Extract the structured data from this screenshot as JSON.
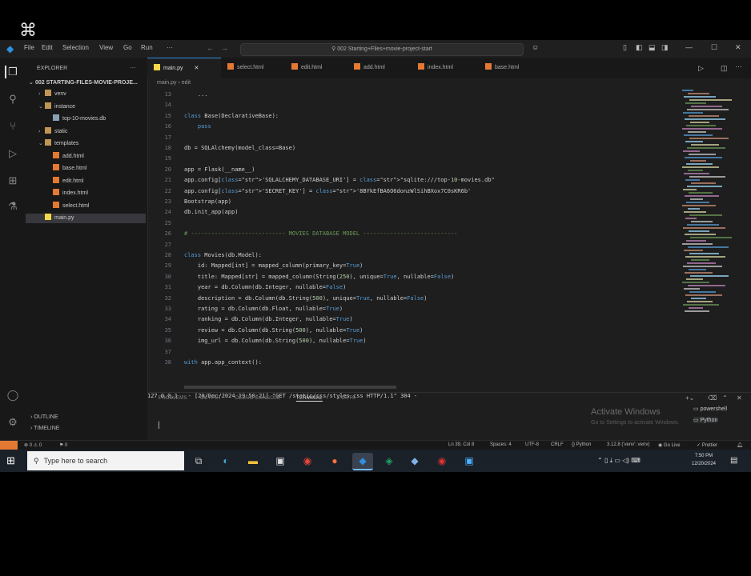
{
  "app": {
    "window_title": "002 Starting+Files+movie-project-start",
    "menu": [
      "File",
      "Edit",
      "Selection",
      "View",
      "Go",
      "Run",
      "···"
    ]
  },
  "sidebar": {
    "header": "EXPLORER",
    "root": "002 STARTING-FILES-MOVIE-PROJE...",
    "items": [
      {
        "label": "venv",
        "kind": "folder",
        "depth": 1
      },
      {
        "label": "instance",
        "kind": "folder",
        "depth": 1
      },
      {
        "label": "top-10-movies.db",
        "kind": "file",
        "depth": 2
      },
      {
        "label": "static",
        "kind": "folder",
        "depth": 1
      },
      {
        "label": "templates",
        "kind": "folder",
        "depth": 1
      },
      {
        "label": "add.html",
        "kind": "html",
        "depth": 2
      },
      {
        "label": "base.html",
        "kind": "html",
        "depth": 2
      },
      {
        "label": "edit.html",
        "kind": "html",
        "depth": 2
      },
      {
        "label": "index.html",
        "kind": "html",
        "depth": 2
      },
      {
        "label": "select.html",
        "kind": "html",
        "depth": 2
      },
      {
        "label": "main.py",
        "kind": "py",
        "depth": 1,
        "selected": true
      }
    ],
    "outline": "OUTLINE",
    "timeline": "TIMELINE"
  },
  "tabs": [
    {
      "label": "main.py",
      "active": true
    },
    {
      "label": "select.html"
    },
    {
      "label": "edit.html"
    },
    {
      "label": "add.html"
    },
    {
      "label": "index.html"
    },
    {
      "label": "base.html"
    }
  ],
  "breadcrumb": {
    "file": "main.py",
    "symbol": "edit"
  },
  "editor": {
    "lines": [
      {
        "n": "13",
        "code": "    ..."
      },
      {
        "n": "14",
        "code": ""
      },
      {
        "n": "15",
        "code": "class Base(DeclarativeBase):"
      },
      {
        "n": "16",
        "code": "    pass"
      },
      {
        "n": "17",
        "code": ""
      },
      {
        "n": "18",
        "code": "db = SQLAlchemy(model_class=Base)"
      },
      {
        "n": "19",
        "code": ""
      },
      {
        "n": "20",
        "code": "app = Flask(__name__)"
      },
      {
        "n": "21",
        "code": "app.config['SQLALCHEMY_DATABASE_URI'] = \"sqlite:///top-10-movies.db\""
      },
      {
        "n": "22",
        "code": "app.config['SECRET_KEY'] = '8BYkEfBA6O6donzWlSihBXox7C0sKR6b'"
      },
      {
        "n": "23",
        "code": "Bootstrap(app)"
      },
      {
        "n": "24",
        "code": "db.init_app(app)"
      },
      {
        "n": "25",
        "code": ""
      },
      {
        "n": "26",
        "code": "# ---------------------------- MOVIES DATABASE MODEL ----------------------------"
      },
      {
        "n": "27",
        "code": ""
      },
      {
        "n": "28",
        "code": "class Movies(db.Model):"
      },
      {
        "n": "29",
        "code": "    id: Mapped[int] = mapped_column(primary_key=True)"
      },
      {
        "n": "30",
        "code": "    title: Mapped[str] = mapped_column(String(250), unique=True, nullable=False)"
      },
      {
        "n": "31",
        "code": "    year = db.Column(db.Integer, nullable=False)"
      },
      {
        "n": "32",
        "code": "    description = db.Column(db.String(500), unique=True, nullable=False)"
      },
      {
        "n": "33",
        "code": "    rating = db.Column(db.Float, nullable=True)"
      },
      {
        "n": "34",
        "code": "    ranking = db.Column(db.Integer, nullable=True)"
      },
      {
        "n": "35",
        "code": "    review = db.Column(db.String(500), nullable=True)"
      },
      {
        "n": "36",
        "code": "    img_url = db.Column(db.String(500), nullable=True)"
      },
      {
        "n": "37",
        "code": ""
      },
      {
        "n": "38",
        "code": "with app.app_context():"
      }
    ]
  },
  "panel": {
    "tabs": [
      "PROBLEMS",
      "OUTPUT",
      "DEBUG CONSOLE",
      "TERMINAL",
      "PORTS"
    ],
    "active_tab": "TERMINAL",
    "terminal_line": "127.0.0.1 - - [20/Dec/2024 19:50:21] \"GET /static/css/styles.css HTTP/1.1\" 304 -",
    "prompt": "▏",
    "terminals": [
      "powershell",
      "Python"
    ],
    "watermark_title": "Activate Windows",
    "watermark_sub": "Go to Settings to activate Windows."
  },
  "statusbar": {
    "problems": "⊗ 0 ⚠ 0",
    "ports": "⚑ 0",
    "position": "Ln 39, Col 8",
    "spaces": "Spaces: 4",
    "encoding": "UTF-8",
    "eol": "CRLF",
    "language": "{} Python",
    "interpreter": "3.12.8 ('venv': venv)",
    "golive": "◉ Go Live",
    "prettier": "✓ Prettier"
  },
  "taskbar": {
    "search_placeholder": "Type here to search",
    "time": "7:50 PM",
    "date": "12/20/2024"
  },
  "colors": {
    "accent": "#2f8fe0",
    "remote": "#e37933",
    "editor_bg": "#1e1e1e",
    "taskbar_bg": "#1b2129"
  }
}
